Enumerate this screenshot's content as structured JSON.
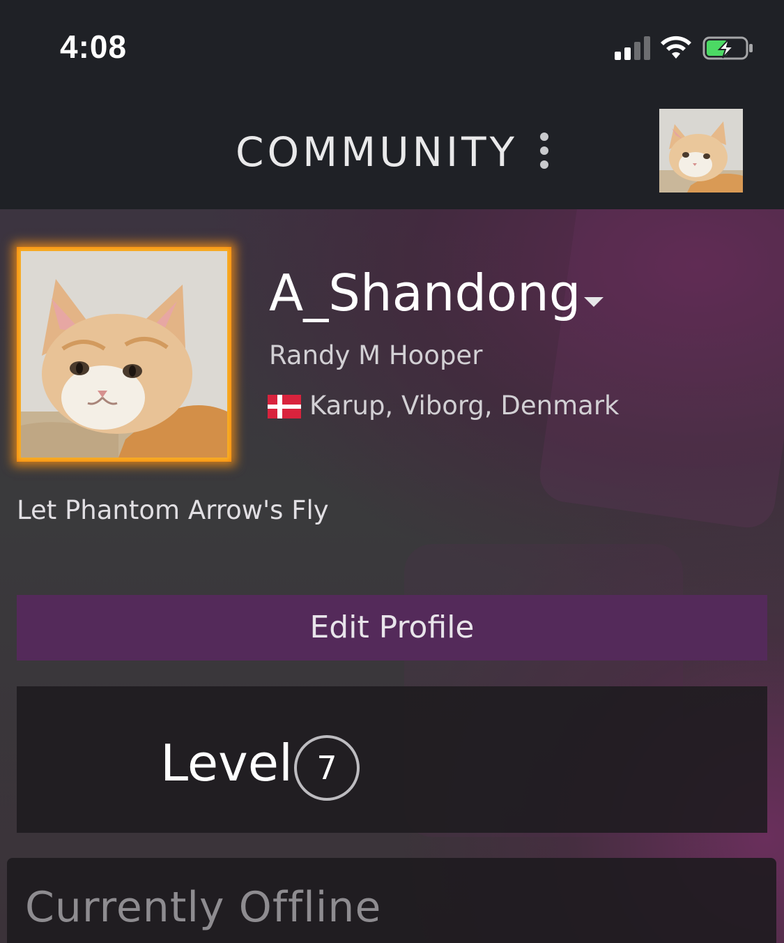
{
  "status_bar": {
    "time": "4:08",
    "signal_icon": "signal-icon",
    "wifi_icon": "wifi-icon",
    "battery_icon": "battery-charging-icon"
  },
  "header": {
    "title": "COMMUNITY",
    "menu_icon": "more-vertical-icon"
  },
  "profile": {
    "display_name": "A_Shandong",
    "real_name": "Randy M Hooper",
    "location": "Karup, Viborg, Denmark",
    "summary": "Let Phantom Arrow's Fly",
    "edit_button": "Edit Profile",
    "level_label": "Level",
    "level_value": "7",
    "status": "Currently Offline"
  },
  "colors": {
    "accent_purple": "#542a5a",
    "frame_orange": "#f6b027",
    "header_bg": "#1f2126"
  }
}
